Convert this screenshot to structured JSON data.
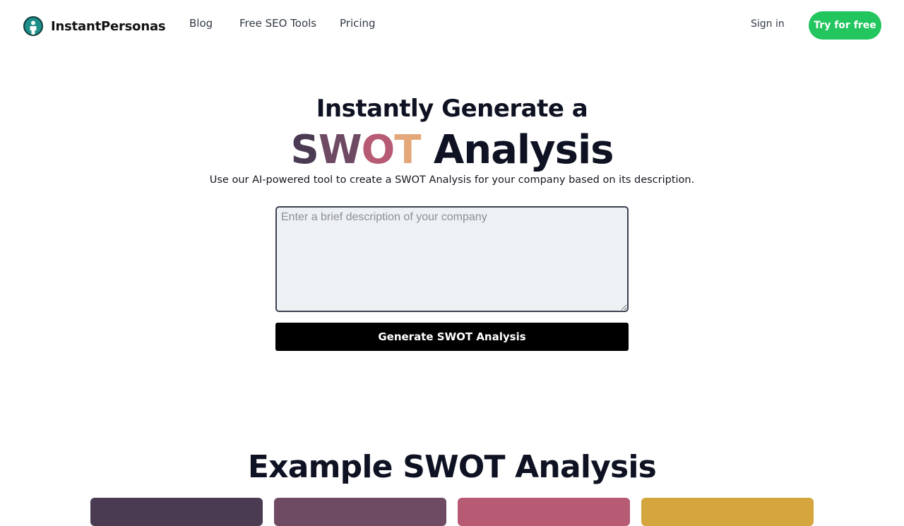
{
  "header": {
    "brand": "InstantPersonas",
    "logo_icon": "person-avatar-icon",
    "nav": [
      {
        "label": "Blog"
      },
      {
        "label": "Free SEO Tools"
      },
      {
        "label": "Pricing"
      }
    ],
    "sign_in": "Sign in",
    "cta": "Try for free"
  },
  "hero": {
    "line1": "Instantly Generate a",
    "swot_letters": [
      "S",
      "W",
      "O",
      "T"
    ],
    "line2_rest": " Analysis",
    "subtitle": "Use our AI-powered tool to create a SWOT Analysis for your company based on its description."
  },
  "form": {
    "placeholder": "Enter a brief description of your company",
    "value": "",
    "button": "Generate SWOT Analysis"
  },
  "example": {
    "title": "Example SWOT Analysis",
    "cards": [
      {
        "color": "#4a3b53"
      },
      {
        "color": "#6e4a63"
      },
      {
        "color": "#b75a73"
      },
      {
        "color": "#d4a63d"
      }
    ]
  },
  "colors": {
    "accent_green": "#22c55e",
    "swot_s": "#4a3b53",
    "swot_w": "#6e4a63",
    "swot_o": "#b75a73",
    "swot_t": "#e3a77a"
  }
}
